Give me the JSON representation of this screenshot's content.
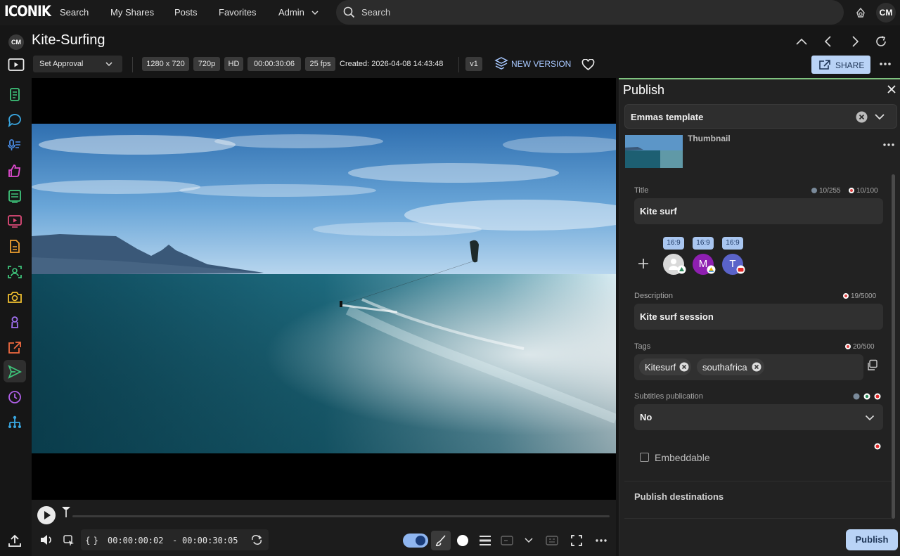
{
  "app": {
    "logo": "ICONIK",
    "user_initials": "CM"
  },
  "nav": {
    "links": [
      "Search",
      "My Shares",
      "Posts",
      "Favorites",
      "Admin"
    ],
    "search_placeholder": "Search"
  },
  "asset": {
    "owner_initials": "CM",
    "title": "Kite-Surfing"
  },
  "toolbar": {
    "approval": "Set Approval",
    "chips": [
      "1280 x 720",
      "720p",
      "HD",
      "00:00:30:06",
      "25 fps"
    ],
    "created": "Created: 2026-04-08 14:43:48",
    "version": "v1",
    "new_version": "NEW VERSION",
    "share": "SHARE"
  },
  "player": {
    "time_in": "00:00:00:02",
    "separator": "-",
    "time_out": "00:00:30:05",
    "braces": "{ }"
  },
  "publish": {
    "title": "Publish",
    "template": "Emmas template",
    "thumbnail_label": "Thumbnail",
    "title_field": {
      "label": "Title",
      "value": "Kite surf",
      "count_a": "10/255",
      "count_b": "10/100"
    },
    "ratios": [
      "16:9",
      "16:9",
      "16:9"
    ],
    "accounts": [
      {
        "initial": "",
        "color": "#d9d9d9"
      },
      {
        "initial": "M",
        "color": "#8e1fb0"
      },
      {
        "initial": "T",
        "color": "#5a63c9"
      }
    ],
    "description": {
      "label": "Description",
      "value": "Kite surf session",
      "count": "19/5000"
    },
    "tags": {
      "label": "Tags",
      "count": "20/500",
      "items": [
        "Kitesurf",
        "southafrica"
      ]
    },
    "subtitles": {
      "label": "Subtitles publication",
      "value": "No"
    },
    "embeddable": "Embeddable",
    "destinations": "Publish destinations",
    "publish_button": "Publish"
  },
  "colors": {
    "accent": "#b9d3f6",
    "link": "#a8c8ff",
    "panel_bg": "#222222"
  },
  "icons": {
    "sidebar": [
      "document-icon",
      "comment-icon",
      "transcript-icon",
      "approve-icon",
      "list-icon",
      "media-icon",
      "file-icon",
      "face-icon",
      "camera-icon",
      "person-icon",
      "export-icon",
      "send-icon",
      "history-icon",
      "hierarchy-icon",
      "upload-icon"
    ]
  }
}
